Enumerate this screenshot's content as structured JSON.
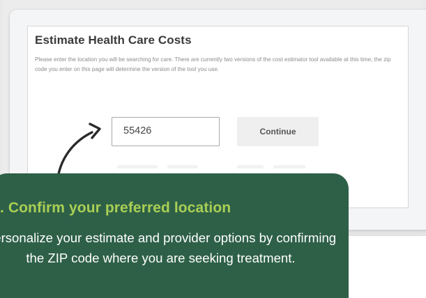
{
  "estimator": {
    "heading": "Estimate Health Care Costs",
    "description": "Please enter the location you will be searching for care. There are currently two versions of the cost estimator tool available at this time; the zip code you enter on this page will determine the version of the tool you use.",
    "zip_value": "55426",
    "continue_label": "Continue"
  },
  "callout": {
    "title": ". Confirm your preferred location",
    "body": "Personalize your estimate and provider options by confirming the ZIP code where you are seeking treatment."
  },
  "colors": {
    "callout_background": "#2e6048",
    "callout_title": "#a9cf54",
    "arrow": "#2a2a2a"
  },
  "icons": {
    "arrow": "curved-arrow-icon"
  }
}
